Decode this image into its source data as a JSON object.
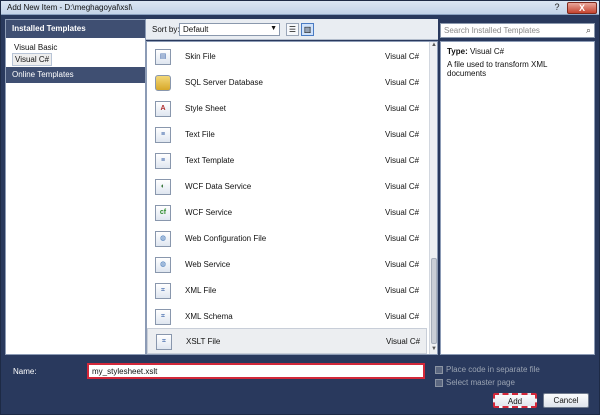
{
  "window": {
    "title": "Add New Item - D:\\meghagoyal\\xsl\\",
    "help": "?",
    "close": "X"
  },
  "left_pane": {
    "header": "Installed Templates",
    "items": [
      "Visual Basic",
      "Visual C#"
    ],
    "selected_item": "Visual C#",
    "online": "Online Templates"
  },
  "toolbar": {
    "sort_label": "Sort by:",
    "sort_value": "Default",
    "view_buttons": [
      "list-view-icon",
      "detail-view-icon"
    ]
  },
  "search": {
    "placeholder": "Search Installed Templates"
  },
  "templates": [
    {
      "name": "Skin File",
      "type": "Visual C#",
      "icon": "skin-file-icon"
    },
    {
      "name": "SQL Server Database",
      "type": "Visual C#",
      "icon": "database-icon"
    },
    {
      "name": "Style Sheet",
      "type": "Visual C#",
      "icon": "stylesheet-icon"
    },
    {
      "name": "Text File",
      "type": "Visual C#",
      "icon": "text-file-icon"
    },
    {
      "name": "Text Template",
      "type": "Visual C#",
      "icon": "text-template-icon"
    },
    {
      "name": "WCF Data Service",
      "type": "Visual C#",
      "icon": "wcf-data-service-icon"
    },
    {
      "name": "WCF Service",
      "type": "Visual C#",
      "icon": "wcf-service-icon"
    },
    {
      "name": "Web Configuration File",
      "type": "Visual C#",
      "icon": "web-config-icon"
    },
    {
      "name": "Web Service",
      "type": "Visual C#",
      "icon": "web-service-icon"
    },
    {
      "name": "XML File",
      "type": "Visual C#",
      "icon": "xml-file-icon"
    },
    {
      "name": "XML Schema",
      "type": "Visual C#",
      "icon": "xml-schema-icon"
    },
    {
      "name": "XSLT File",
      "type": "Visual C#",
      "icon": "xslt-file-icon"
    }
  ],
  "selected_template": "XSLT File",
  "description": {
    "type_key": "Type:",
    "type_value": "Visual C#",
    "text": "A file used to transform XML documents"
  },
  "bottom": {
    "name_label": "Name:",
    "name_value": "my_stylesheet.xslt",
    "place_code_label": "Place code in separate file",
    "select_master_label": "Select master page",
    "add_label": "Add",
    "cancel_label": "Cancel"
  },
  "colors": {
    "frame": "#29395d",
    "header": "#3f4f72",
    "highlight_red": "#d3283a"
  }
}
